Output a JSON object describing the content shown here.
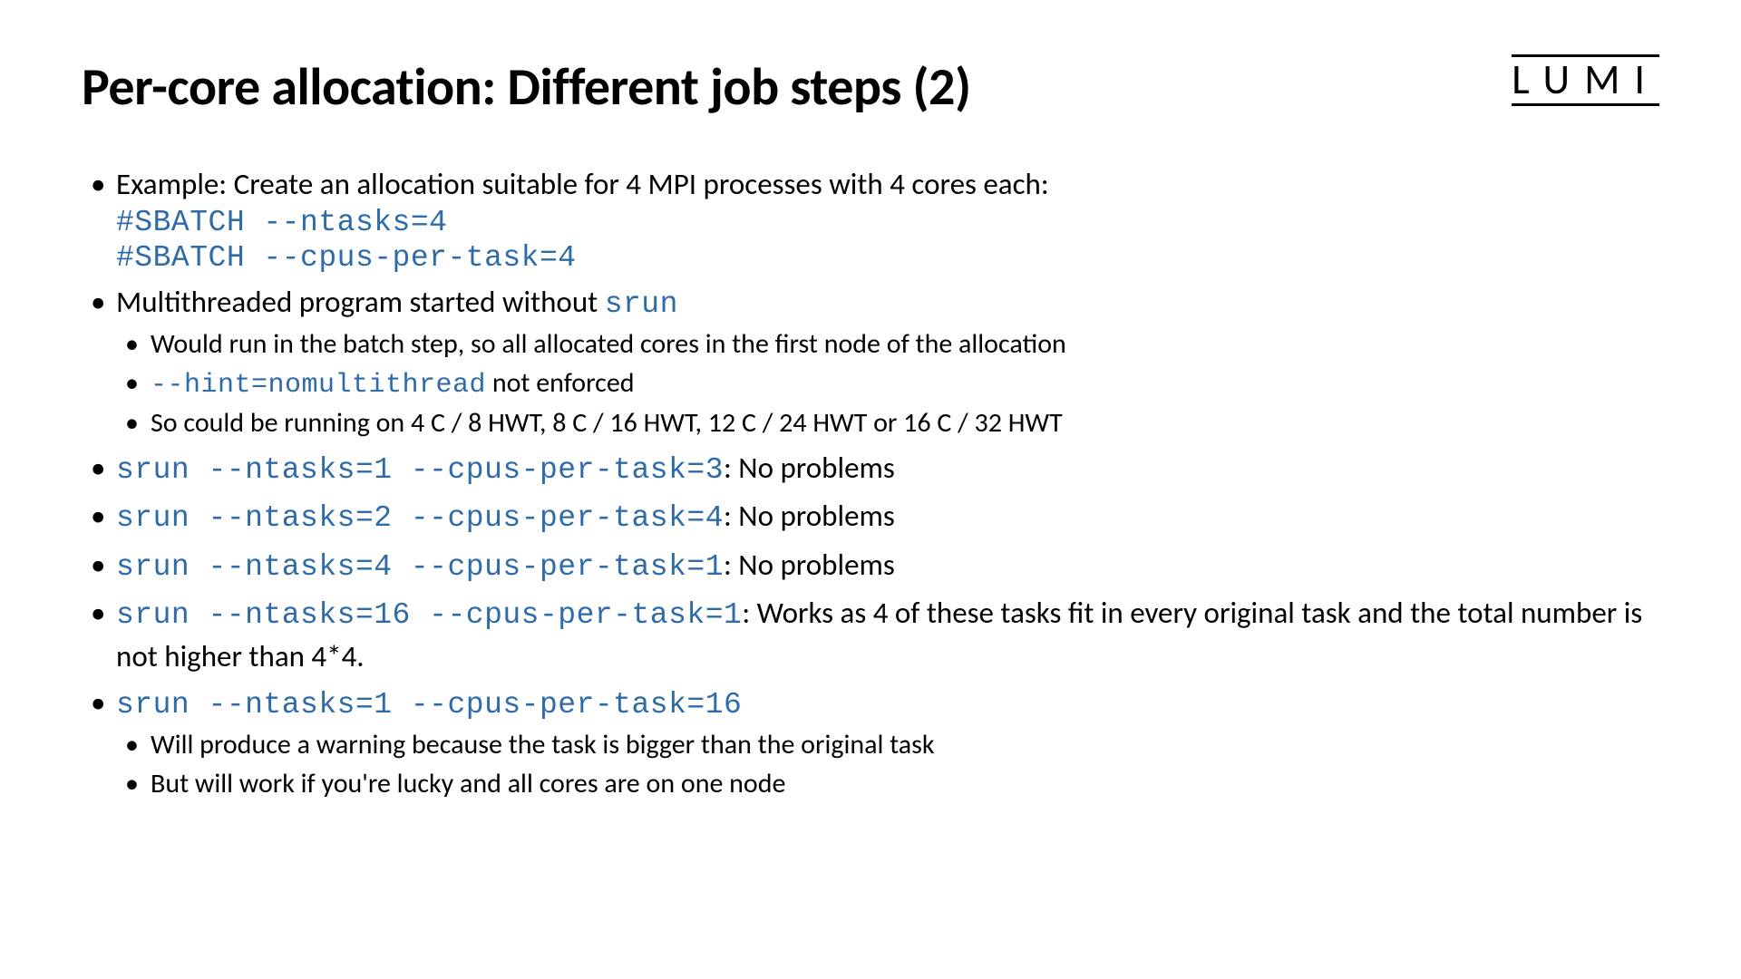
{
  "title": "Per-core allocation: Different job steps (2)",
  "logo": "LUMI",
  "bullets": [
    {
      "text_before": "Example: Create an allocation suitable for 4 MPI processes with 4 cores each:",
      "code_lines": [
        "#SBATCH --ntasks=4",
        "#SBATCH --cpus-per-task=4"
      ]
    },
    {
      "text_before": "Multithreaded program started without ",
      "code_inline": "srun",
      "sub": [
        {
          "text": "Would run in the batch step, so all allocated cores in the first node of the allocation"
        },
        {
          "code": "--hint=nomultithread",
          "text_after": " not enforced"
        },
        {
          "text": "So could be running on 4 C / 8 HWT, 8 C / 16 HWT, 12 C / 24 HWT or 16 C / 32 HWT"
        }
      ]
    },
    {
      "code_inline": "srun --ntasks=1 --cpus-per-task=3",
      "text_after": ": No problems"
    },
    {
      "code_inline": "srun --ntasks=2 --cpus-per-task=4",
      "text_after": ": No problems"
    },
    {
      "code_inline": "srun --ntasks=4 --cpus-per-task=1",
      "text_after": ": No problems"
    },
    {
      "code_inline": "srun --ntasks=16 --cpus-per-task=1",
      "text_after": ": Works as 4 of these tasks fit in every original task and the total number is not higher than 4*4."
    },
    {
      "code_inline": "srun --ntasks=1 --cpus-per-task=16",
      "sub": [
        {
          "text": "Will produce a warning because the task is bigger than the original task"
        },
        {
          "text": "But will work if you're lucky and all cores are on one node"
        }
      ]
    }
  ]
}
